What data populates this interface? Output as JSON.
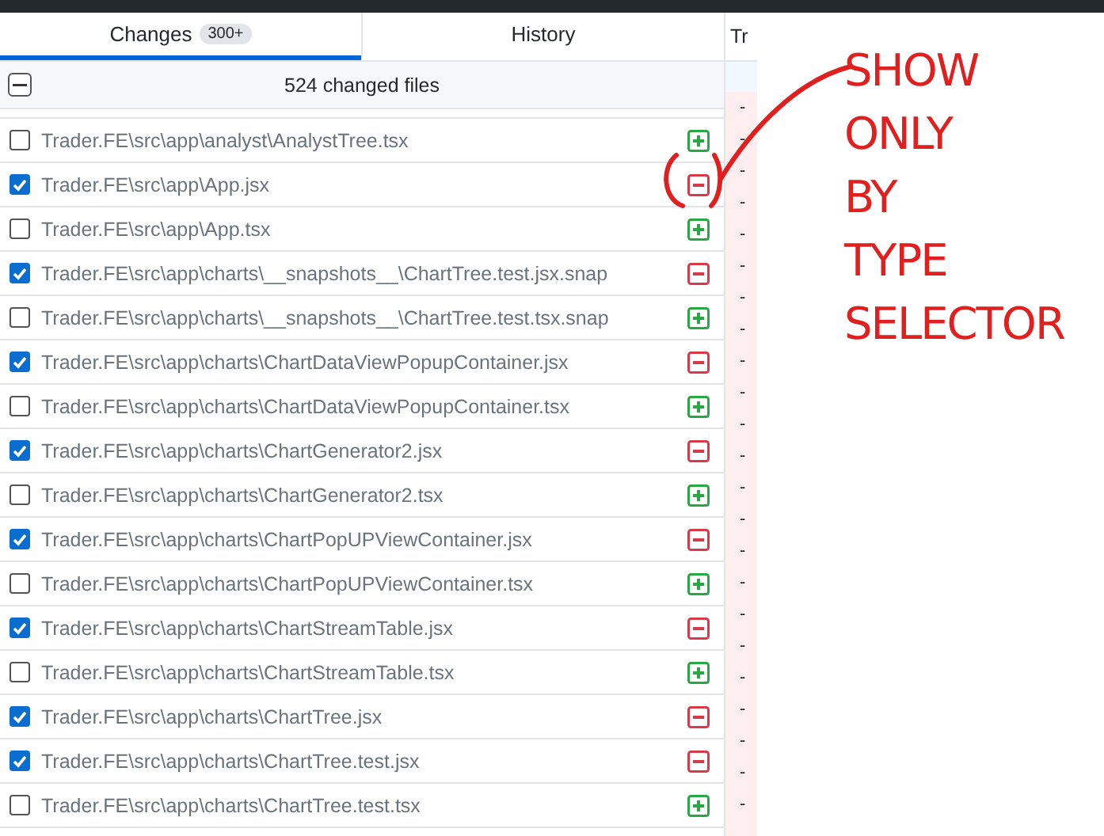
{
  "tabs": [
    {
      "label": "Changes",
      "badge": "300+",
      "selected": true
    },
    {
      "label": "History",
      "selected": false
    }
  ],
  "changes_header": {
    "indeterminate": true,
    "summary": "524 changed files"
  },
  "files": [
    {
      "path": "Trader.FE\\src\\app\\analyst\\AnalystTree.tsx",
      "checked": false,
      "kind": "added"
    },
    {
      "path": "Trader.FE\\src\\app\\App.jsx",
      "checked": true,
      "kind": "deleted"
    },
    {
      "path": "Trader.FE\\src\\app\\App.tsx",
      "checked": false,
      "kind": "added"
    },
    {
      "path": "Trader.FE\\src\\app\\charts\\__snapshots__\\ChartTree.test.jsx.snap",
      "checked": true,
      "kind": "deleted"
    },
    {
      "path": "Trader.FE\\src\\app\\charts\\__snapshots__\\ChartTree.test.tsx.snap",
      "checked": false,
      "kind": "added"
    },
    {
      "path": "Trader.FE\\src\\app\\charts\\ChartDataViewPopupContainer.jsx",
      "checked": true,
      "kind": "deleted"
    },
    {
      "path": "Trader.FE\\src\\app\\charts\\ChartDataViewPopupContainer.tsx",
      "checked": false,
      "kind": "added"
    },
    {
      "path": "Trader.FE\\src\\app\\charts\\ChartGenerator2.jsx",
      "checked": true,
      "kind": "deleted"
    },
    {
      "path": "Trader.FE\\src\\app\\charts\\ChartGenerator2.tsx",
      "checked": false,
      "kind": "added"
    },
    {
      "path": "Trader.FE\\src\\app\\charts\\ChartPopUPViewContainer.jsx",
      "checked": true,
      "kind": "deleted"
    },
    {
      "path": "Trader.FE\\src\\app\\charts\\ChartPopUPViewContainer.tsx",
      "checked": false,
      "kind": "added"
    },
    {
      "path": "Trader.FE\\src\\app\\charts\\ChartStreamTable.jsx",
      "checked": true,
      "kind": "deleted"
    },
    {
      "path": "Trader.FE\\src\\app\\charts\\ChartStreamTable.tsx",
      "checked": false,
      "kind": "added"
    },
    {
      "path": "Trader.FE\\src\\app\\charts\\ChartTree.jsx",
      "checked": true,
      "kind": "deleted"
    },
    {
      "path": "Trader.FE\\src\\app\\charts\\ChartTree.test.jsx",
      "checked": true,
      "kind": "deleted"
    },
    {
      "path": "Trader.FE\\src\\app\\charts\\ChartTree.test.tsx",
      "checked": false,
      "kind": "added"
    }
  ],
  "diff": {
    "header": "Tr",
    "lines": [
      "-",
      "-",
      "-",
      "-",
      "-",
      "-",
      "-",
      "-",
      "-",
      "-",
      "-",
      "-",
      "-",
      "-",
      "-",
      "-",
      "-",
      "-",
      "-",
      "-",
      "-",
      "-",
      "-"
    ]
  },
  "annotation": {
    "lines": [
      "SHOW",
      "ONLY",
      "BY",
      "TYPE",
      "SELECTOR"
    ]
  }
}
